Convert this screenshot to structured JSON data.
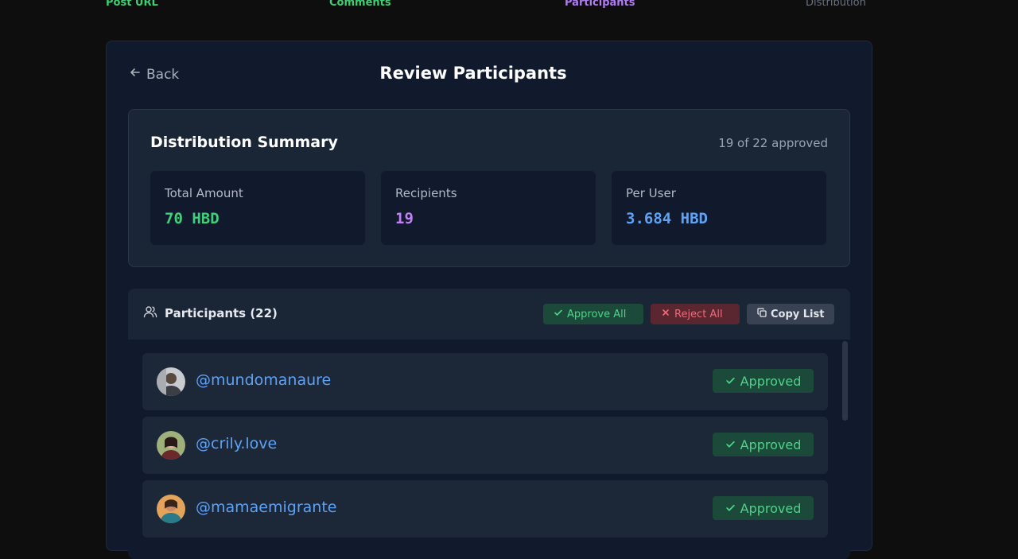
{
  "steps": [
    "Post URL",
    "Comments",
    "Participants",
    "Distribution"
  ],
  "header": {
    "back_label": "Back",
    "title": "Review Participants"
  },
  "summary": {
    "title": "Distribution Summary",
    "approved_count": "19 of 22 approved",
    "stats": [
      {
        "label": "Total Amount",
        "value": "70 HBD",
        "color": "#3fd07a"
      },
      {
        "label": "Recipients",
        "value": "19",
        "color": "#c081f7"
      },
      {
        "label": "Per User",
        "value": "3.684 HBD",
        "color": "#5ea2f5"
      }
    ]
  },
  "participants": {
    "title": "Participants (22)",
    "approve_all_label": "Approve All",
    "reject_all_label": "Reject All",
    "copy_list_label": "Copy List",
    "items": [
      {
        "username": "@mundomanaure",
        "status": "Approved"
      },
      {
        "username": "@crily.love",
        "status": "Approved"
      },
      {
        "username": "@mamaemigrante",
        "status": "Approved"
      }
    ]
  },
  "colors": {
    "accent_green": "#3fcf73",
    "accent_purple": "#b07cf5",
    "link_blue": "#5ea2f5",
    "danger_red": "#f06a7a"
  }
}
